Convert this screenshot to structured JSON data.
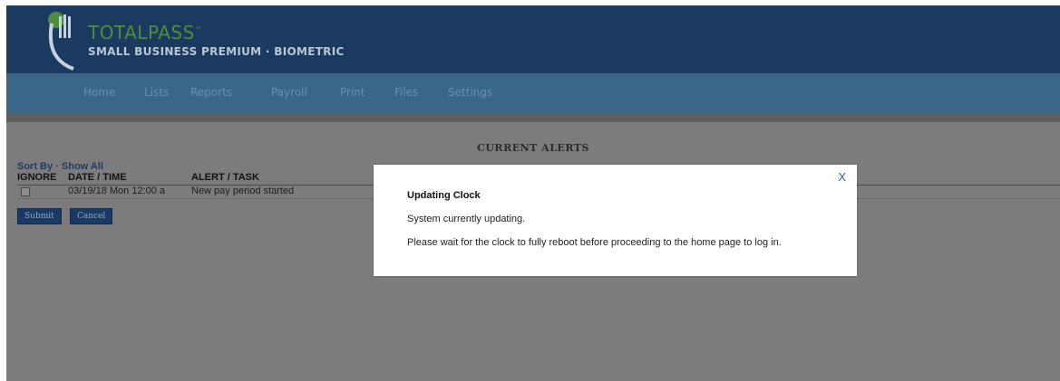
{
  "header": {
    "logo_name": "TOTALPASS",
    "logo_tm": "™",
    "logo_subtitle": "SMALL BUSINESS PREMIUM · BIOMETRIC"
  },
  "nav": {
    "items": [
      "Home",
      "Lists",
      "Reports",
      "Payroll",
      "Print",
      "Files",
      "Settings"
    ]
  },
  "alerts": {
    "title": "CURRENT ALERTS",
    "sort_by_label": "Sort By",
    "sort_separator": " · ",
    "show_all_label": "Show All",
    "columns": [
      "IGNORE",
      "DATE / TIME",
      "ALERT / TASK"
    ],
    "rows": [
      {
        "date_time": "03/19/18 Mon 12:00 a",
        "alert": "New pay period started",
        "ignored": false
      }
    ],
    "submit_label": "Submit",
    "cancel_label": "Cancel"
  },
  "modal": {
    "close_label": "X",
    "title": "Updating Clock",
    "line1": "System currently updating.",
    "line2": "Please wait for the clock to fully reboot before proceeding to the home page to log in."
  },
  "colors": {
    "header_bg": "#1a3a60",
    "nav_bg": "#3a6688",
    "logo_green": "#4d8f3c",
    "overlay_gray": "#7c7c7c",
    "button_bg": "#1a3a66",
    "modal_close": "#2b5e9e"
  }
}
